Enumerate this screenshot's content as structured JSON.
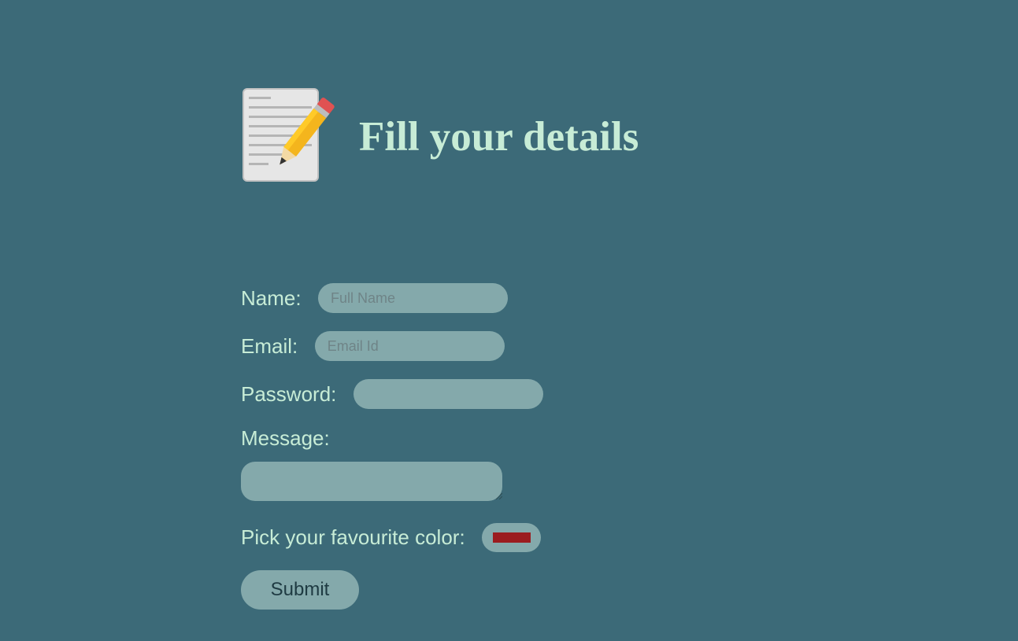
{
  "header": {
    "icon": "memo-icon",
    "title": "Fill your details"
  },
  "form": {
    "name_label": "Name:",
    "name_placeholder": "Full Name",
    "email_label": "Email:",
    "email_placeholder": "Email Id",
    "password_label": "Password:",
    "message_label": "Message:",
    "color_label": "Pick your favourite color:",
    "color_value": "#9b1c1f",
    "submit_label": "Submit"
  },
  "colors": {
    "background": "#3c6a78",
    "text": "#c7ecd6",
    "field": "#84a9ab",
    "button_text": "#1e3a42"
  }
}
